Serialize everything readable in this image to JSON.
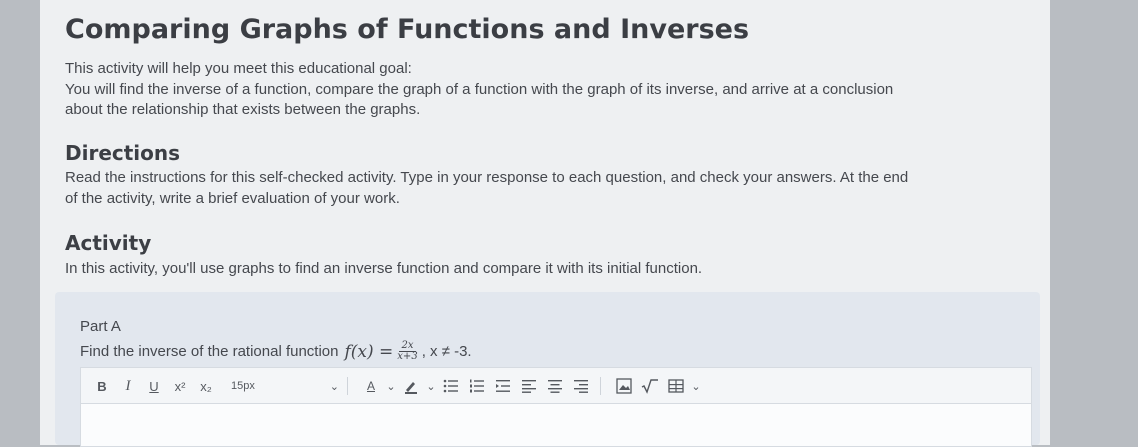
{
  "title": "Comparing Graphs of Functions and Inverses",
  "intro": {
    "line1": "This activity will help you meet this educational goal:",
    "line2": "You will find the inverse of a function, compare the graph of a function with the graph of its inverse, and arrive at a conclusion",
    "line3": "about the relationship that exists between the graphs."
  },
  "directions": {
    "heading": "Directions",
    "line1": "Read the instructions for this self-checked activity. Type in your response to each question, and check your answers. At the end",
    "line2": "of the activity, write a brief evaluation of your work."
  },
  "activity": {
    "heading": "Activity",
    "text": "In this activity, you'll use graphs to find an inverse function and compare it with its initial function."
  },
  "part_a": {
    "title": "Part A",
    "question": "Find the inverse of the rational function",
    "fx": "f(x) =",
    "numerator": "2x",
    "denominator": "x+3",
    "condition": ", x ≠ -3."
  },
  "toolbar": {
    "bold": "B",
    "italic": "I",
    "underline": "U",
    "superscript": "x²",
    "subscript": "x₂",
    "font_size": "15px",
    "font_color": "A",
    "icons": [
      "bold-icon",
      "italic-icon",
      "underline-icon",
      "superscript-icon",
      "subscript-icon",
      "font-size-select",
      "font-color-icon",
      "highlight-icon",
      "bullet-list-icon",
      "numbered-list-icon",
      "indent-icon",
      "align-left-icon",
      "align-center-icon",
      "align-right-icon",
      "image-icon",
      "math-icon",
      "table-icon"
    ]
  }
}
